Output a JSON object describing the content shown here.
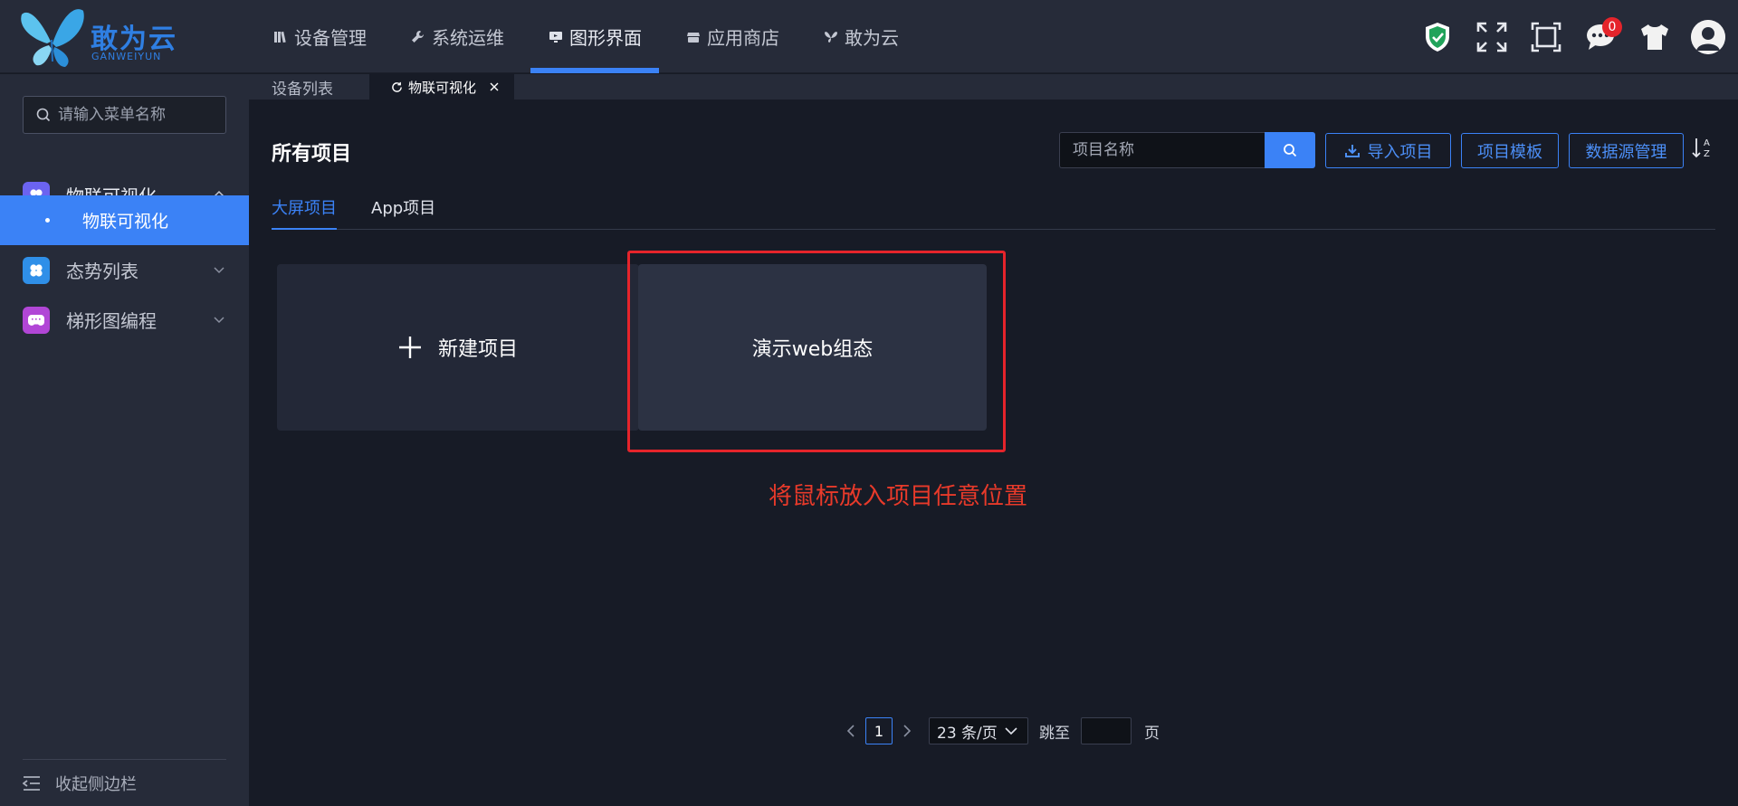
{
  "brand": {
    "name": "敢为云",
    "sub": "GANWEIYUN",
    "color": "#2f7fe3"
  },
  "nav": [
    {
      "label": "设备管理",
      "icon": "books-icon"
    },
    {
      "label": "系统运维",
      "icon": "wrench-icon"
    },
    {
      "label": "图形界面",
      "icon": "monitor-icon",
      "active": true
    },
    {
      "label": "应用商店",
      "icon": "store-icon"
    },
    {
      "label": "敢为云",
      "icon": "butterfly-icon"
    }
  ],
  "top_icons": {
    "notification_count": "0",
    "icons": [
      "shield-check-icon",
      "fullscreen-icon",
      "frame-icon",
      "message-icon",
      "tshirt-icon",
      "user-avatar-icon"
    ]
  },
  "sidebar": {
    "search_placeholder": "请输入菜单名称",
    "groups": [
      {
        "label": "物联可视化",
        "icon": "clover-icon",
        "color": "#6b63f0",
        "expanded": true,
        "children": [
          "物联可视化"
        ]
      },
      {
        "label": "态势列表",
        "icon": "clover-icon",
        "color": "#2f8fe8"
      },
      {
        "label": "梯形图编程",
        "icon": "gamepad-icon",
        "color": "#b146d6"
      }
    ],
    "collapse_label": "收起侧边栏"
  },
  "tabs": [
    {
      "label": "设备列表"
    },
    {
      "label": "物联可视化",
      "active": true,
      "closable": true
    }
  ],
  "main": {
    "title": "所有项目",
    "search_placeholder": "项目名称",
    "buttons": {
      "import": "导入项目",
      "template": "项目模板",
      "datasource": "数据源管理"
    },
    "subtabs": [
      "大屏项目",
      "App项目"
    ],
    "new_project": "新建项目",
    "project_card": "演示web组态",
    "hint": "将鼠标放入项目任意位置"
  },
  "pager": {
    "current": "1",
    "page_size": "23 条/页",
    "jump_label": "跳至",
    "page_unit": "页"
  },
  "colors": {
    "accent": "#3b82f6",
    "highlight": "#e5242b",
    "bg": "#171b26",
    "panel": "#262b39"
  }
}
